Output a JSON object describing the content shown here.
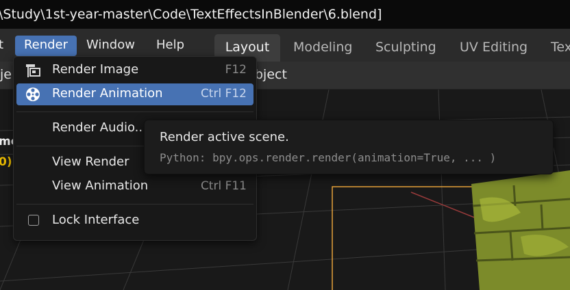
{
  "window": {
    "title": "\\Study\\1st-year-master\\Code\\TextEffectsInBlender\\6.blend]"
  },
  "menubar": {
    "items": [
      {
        "label": "t"
      },
      {
        "label": "Render"
      },
      {
        "label": "Window"
      },
      {
        "label": "Help"
      }
    ]
  },
  "workspaces": [
    "Layout",
    "Modeling",
    "Sculpting",
    "UV Editing",
    "Tex"
  ],
  "header": {
    "left_fragment": "je",
    "object_fragment": "bject"
  },
  "viewport": {
    "text_fragment_1": "me",
    "text_fragment_2": "0)"
  },
  "render_menu": {
    "items": [
      {
        "label": "Render Image",
        "shortcut": "F12",
        "icon": "render-image-icon"
      },
      {
        "label": "Render Animation",
        "shortcut": "Ctrl F12",
        "icon": "render-animation-icon"
      },
      {
        "label": "Render Audio...",
        "shortcut": ""
      },
      {
        "label": "View Render",
        "shortcut": ""
      },
      {
        "label": "View Animation",
        "shortcut": "Ctrl F11"
      },
      {
        "label": "Lock Interface",
        "shortcut": "",
        "icon": "checkbox-icon"
      }
    ]
  },
  "tooltip": {
    "description": "Render active scene.",
    "python": "Python: bpy.ops.render.render(animation=True, ... )"
  },
  "colors": {
    "accent": "#4772b3",
    "selection_outline": "#e8a33a",
    "texture_tint": "#a8b83a"
  }
}
